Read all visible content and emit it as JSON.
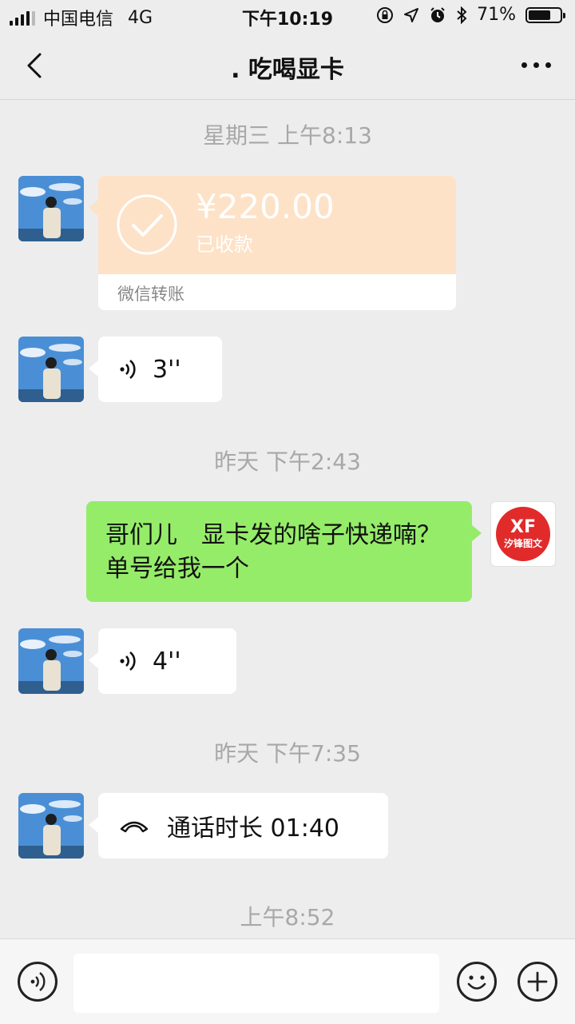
{
  "status_bar": {
    "carrier": "中国电信",
    "network": "4G",
    "time": "下午10:19",
    "battery_percent": "71%",
    "battery_level": 0.71
  },
  "nav": {
    "title": ". 吃喝显卡",
    "back_icon": "chevron-left-icon",
    "more_icon": "more-dots-icon"
  },
  "messages": {
    "ts1": "星期三 上午8:13",
    "transfer_amount": "¥220.00",
    "transfer_status": "已收款",
    "transfer_label": "微信转账",
    "voice1_duration": "3''",
    "ts2": "昨天 下午2:43",
    "my_message": "哥们儿　显卡发的啥子快递喃？单号给我一个",
    "my_avatar_text": "XF",
    "my_avatar_sub": "汐锋图文",
    "voice2_duration": "4''",
    "ts3": "昨天 下午7:35",
    "call_text": "通话时长 01:40",
    "ts4": "上午8:52"
  },
  "input_bar": {
    "voice_icon": "voice-input-icon",
    "emoji_icon": "emoji-icon",
    "plus_icon": "plus-icon"
  },
  "colors": {
    "background": "#ededed",
    "green_bubble": "#95ec69",
    "transfer_orange": "#fde2c7",
    "timestamp": "#a8a8a8"
  }
}
